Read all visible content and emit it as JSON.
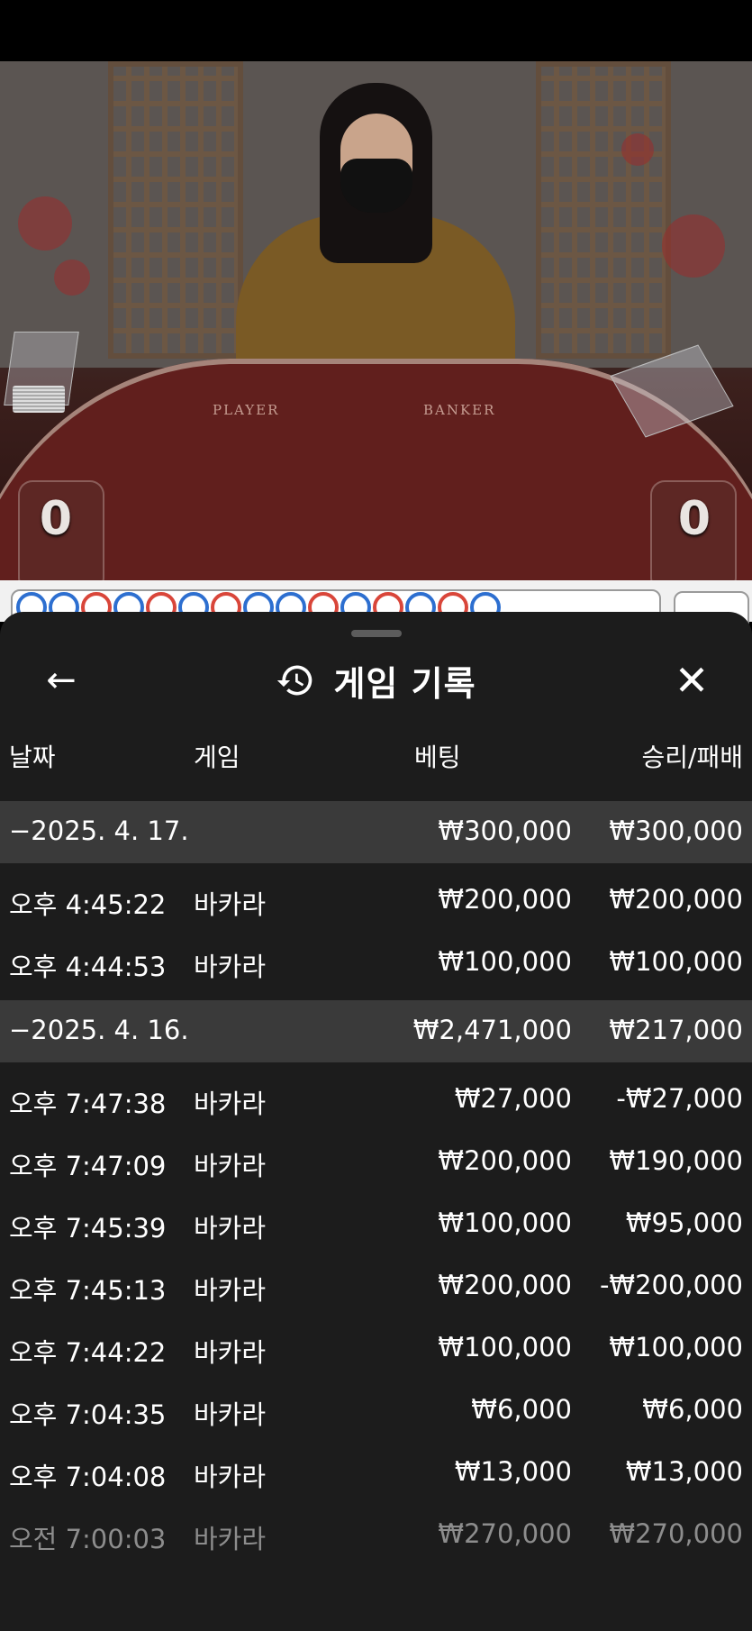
{
  "video": {
    "table_labels": {
      "player": "PLAYER",
      "banker": "BANKER"
    },
    "scores": {
      "player": "0",
      "banker": "0"
    }
  },
  "roadmap": {
    "beads": [
      "blue",
      "blue",
      "red",
      "blue",
      "red",
      "blue",
      "red",
      "blue",
      "blue",
      "red",
      "blue",
      "red",
      "blue",
      "red",
      "blue"
    ]
  },
  "sheet": {
    "back_icon": "arrow-left-icon",
    "close_icon": "close-icon",
    "history_icon": "history-icon",
    "back_glyph": "←",
    "close_glyph": "✕",
    "title": "게임 기록",
    "columns": {
      "date": "날짜",
      "game": "게임",
      "bet": "베팅",
      "win_loss": "승리/패배"
    },
    "days": [
      {
        "date": "−2025. 4. 17.",
        "bet_total": "₩300,000",
        "win_total": "₩300,000",
        "entries": [
          {
            "time": "오후 4:45:22",
            "game": "바카라",
            "bet": "₩200,000",
            "result": "₩200,000"
          },
          {
            "time": "오후 4:44:53",
            "game": "바카라",
            "bet": "₩100,000",
            "result": "₩100,000"
          }
        ]
      },
      {
        "date": "−2025. 4. 16.",
        "bet_total": "₩2,471,000",
        "win_total": "₩217,000",
        "entries": [
          {
            "time": "오후 7:47:38",
            "game": "바카라",
            "bet": "₩27,000",
            "result": "-₩27,000"
          },
          {
            "time": "오후 7:47:09",
            "game": "바카라",
            "bet": "₩200,000",
            "result": "₩190,000"
          },
          {
            "time": "오후 7:45:39",
            "game": "바카라",
            "bet": "₩100,000",
            "result": "₩95,000"
          },
          {
            "time": "오후 7:45:13",
            "game": "바카라",
            "bet": "₩200,000",
            "result": "-₩200,000"
          },
          {
            "time": "오후 7:44:22",
            "game": "바카라",
            "bet": "₩100,000",
            "result": "₩100,000"
          },
          {
            "time": "오후 7:04:35",
            "game": "바카라",
            "bet": "₩6,000",
            "result": "₩6,000"
          },
          {
            "time": "오후 7:04:08",
            "game": "바카라",
            "bet": "₩13,000",
            "result": "₩13,000"
          },
          {
            "time": "오전 7:00:03",
            "game": "바카라",
            "bet": "₩270,000",
            "result": "₩270,000"
          }
        ]
      }
    ]
  }
}
